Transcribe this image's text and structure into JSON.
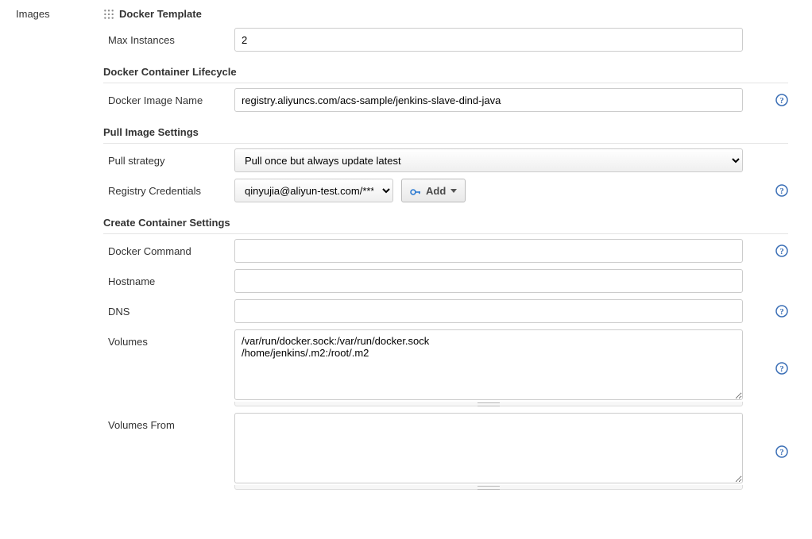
{
  "leftLabel": "Images",
  "templateHeader": "Docker Template",
  "sections": {
    "lifecycle": "Docker Container Lifecycle",
    "pull": "Pull Image Settings",
    "create": "Create Container Settings"
  },
  "labels": {
    "maxInstances": "Max Instances",
    "dockerImageName": "Docker Image Name",
    "pullStrategy": "Pull strategy",
    "registryCredentials": "Registry Credentials",
    "dockerCommand": "Docker Command",
    "hostname": "Hostname",
    "dns": "DNS",
    "volumes": "Volumes",
    "volumesFrom": "Volumes From"
  },
  "values": {
    "maxInstances": "2",
    "dockerImageName": "registry.aliyuncs.com/acs-sample/jenkins-slave-dind-java",
    "pullStrategy": "Pull once but always update latest",
    "registryCredentials": "qinyujia@aliyun-test.com/******",
    "dockerCommand": "",
    "hostname": "",
    "dns": "",
    "volumes": "/var/run/docker.sock:/var/run/docker.sock\n/home/jenkins/.m2:/root/.m2",
    "volumesFrom": ""
  },
  "addButton": "Add"
}
